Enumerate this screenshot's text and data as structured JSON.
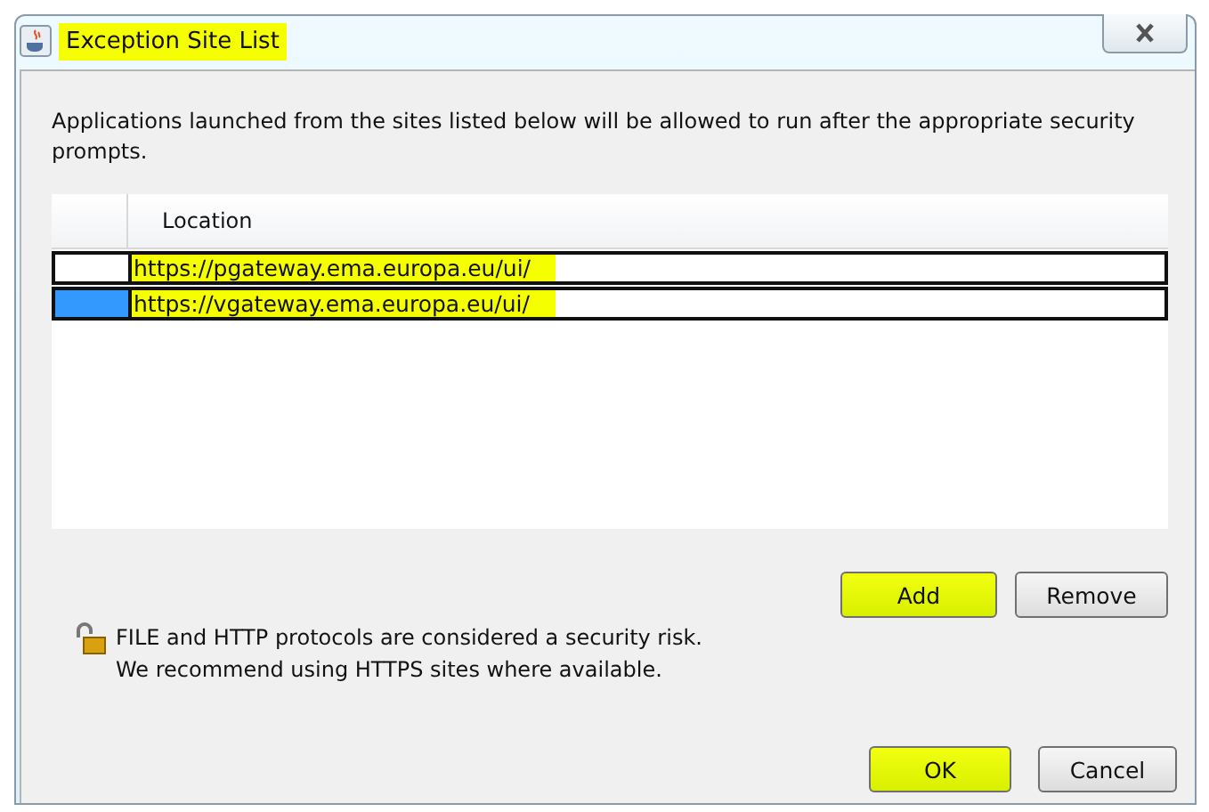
{
  "window": {
    "title": "Exception Site List",
    "title_highlighted": true
  },
  "description": "Applications launched from the sites listed below will be allowed to run after the appropriate security prompts.",
  "table": {
    "columns": [
      "Location"
    ],
    "rows": [
      {
        "location": "https://pgateway.ema.europa.eu/ui/",
        "selected": false,
        "highlighted": true
      },
      {
        "location": "https://vgateway.ema.europa.eu/ui/",
        "selected": true,
        "highlighted": true
      }
    ]
  },
  "list_buttons": [
    {
      "label": "Add",
      "highlighted": true
    },
    {
      "label": "Remove",
      "highlighted": false
    }
  ],
  "warning": [
    "FILE and HTTP protocols are considered a security risk.",
    "We recommend using HTTPS sites where available."
  ],
  "dialog_buttons": [
    {
      "label": "OK",
      "highlighted": true
    },
    {
      "label": "Cancel",
      "highlighted": false
    }
  ]
}
